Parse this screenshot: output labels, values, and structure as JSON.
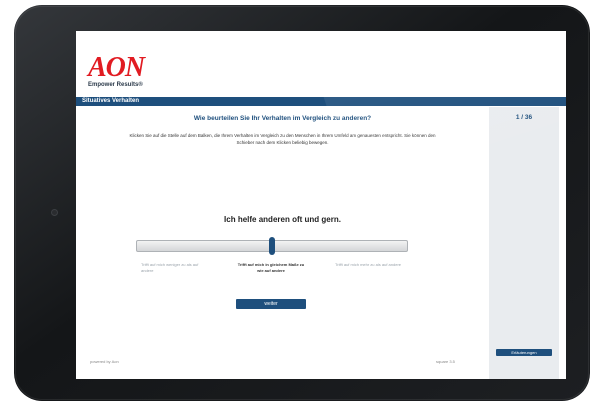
{
  "header": {
    "logo_text": "AON",
    "tagline": "Empower Results®"
  },
  "section": {
    "title": "Situatives Verhalten"
  },
  "progress": {
    "label": "1 / 36"
  },
  "question": {
    "title": "Wie beurteilen Sie Ihr Verhalten im Vergleich zu anderen?",
    "instruction": "Klicken Sie auf die Stelle auf dem Balken, die Ihrem Verhalten im Vergleich zu den Menschen in Ihrem Umfeld am genauesten entspricht. Sie können den Schieber nach dem Klicken beliebig bewegen.",
    "statement": "Ich helfe anderen oft und gern."
  },
  "slider": {
    "value": 0.5,
    "label_left": "Trifft auf mich weniger zu als auf andere",
    "label_mid": "Trifft auf mich in gleichem Maße zu wie auf andere",
    "label_right": "Trifft auf mich mehr zu als auf andere"
  },
  "buttons": {
    "next": "weiter",
    "info": "Erläuterungen"
  },
  "footer": {
    "powered": "powered by Aon",
    "version": "square 3.5"
  },
  "colors": {
    "brand_red": "#e11b22",
    "navy": "#1e4f7d",
    "panel": "#e9ecef"
  }
}
